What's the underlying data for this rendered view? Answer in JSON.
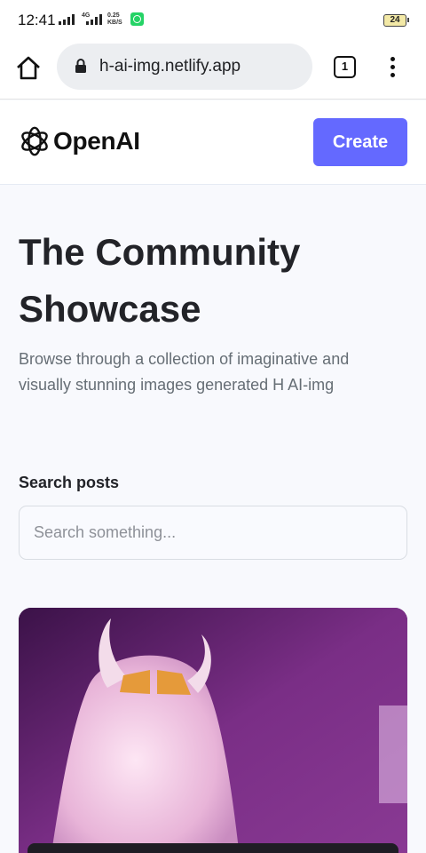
{
  "status_bar": {
    "time": "12:41",
    "network_top": "4G",
    "network_bottom": "",
    "speed_top": "0.25",
    "speed_bottom": "KB/S",
    "battery": "24"
  },
  "browser": {
    "url": "h-ai-img.netlify.app",
    "tab_count": "1"
  },
  "header": {
    "logo_text": "OpenAI",
    "create_label": "Create"
  },
  "hero": {
    "title": "The Community Showcase",
    "subtitle": "Browse through a collection of imaginative and visually stunning images generated H AI-img"
  },
  "search": {
    "label": "Search posts",
    "placeholder": "Search something...",
    "value": ""
  },
  "colors": {
    "accent": "#6469ff",
    "background": "#f8f9fd",
    "title": "#222328",
    "subtitle": "#666e75"
  },
  "icons": [
    "home-icon",
    "lock-icon",
    "tabs-icon",
    "more-vert-icon",
    "openai-logo-icon",
    "whatsapp-icon"
  ]
}
